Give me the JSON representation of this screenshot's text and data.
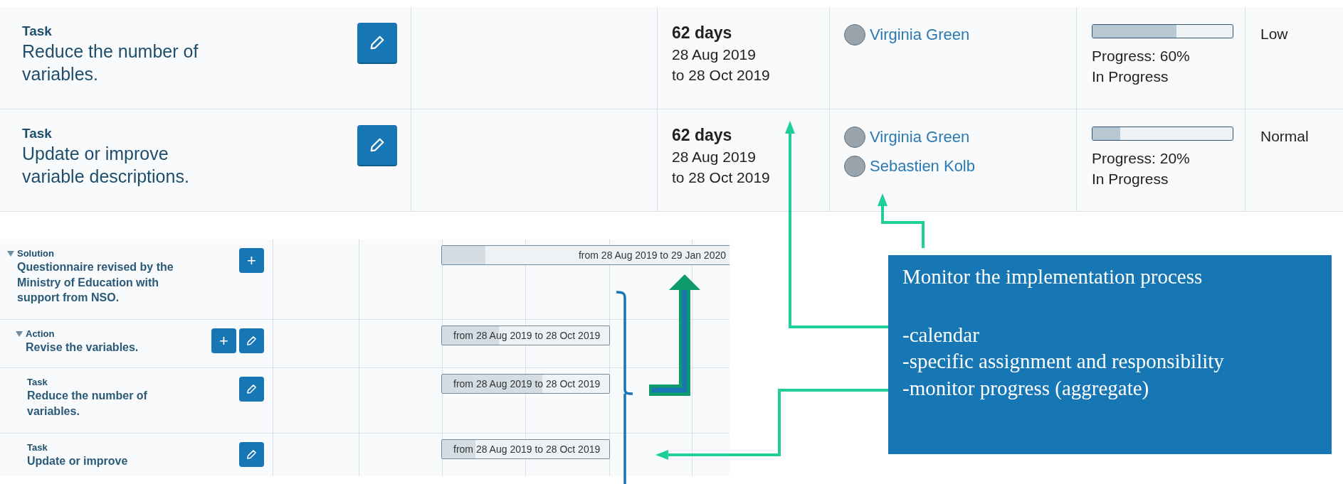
{
  "task_table": {
    "rows": [
      {
        "type_label": "Task",
        "title": "Reduce the number of variables.",
        "duration": "62 days",
        "start": "28 Aug 2019",
        "end": "to 28 Oct 2019",
        "assignees": [
          "Virginia Green"
        ],
        "level": 0.6,
        "progress": "Progress: 60%",
        "status": "In Progress",
        "priority": "Low"
      },
      {
        "type_label": "Task",
        "title": "Update or improve variable descriptions.",
        "duration": "62 days",
        "start": "28 Aug 2019",
        "end": "to 28 Oct 2019",
        "assignees": [
          "Virginia Green",
          "Sebastien Kolb"
        ],
        "level": 0.2,
        "progress": "Progress: 20%",
        "status": "In Progress",
        "priority": "Normal"
      }
    ]
  },
  "gantt": {
    "rows": [
      {
        "kind": "solution",
        "expanded": true,
        "type_label": "Solution",
        "title": "Questionnaire revised by the Ministry of Education with support from NSO.",
        "actions": [
          {
            "kind": "add",
            "label": "+"
          }
        ],
        "bar": "from 28 Aug 2019 to 29 Jan 2020",
        "level": 0.15
      },
      {
        "kind": "action",
        "expanded": true,
        "type_label": "Action",
        "title": "Revise the variables.",
        "actions": [
          {
            "kind": "add",
            "label": "+"
          },
          {
            "kind": "edit"
          }
        ],
        "bar": "from 28 Aug 2019 to 28 Oct 2019",
        "level": 0.34
      },
      {
        "kind": "task",
        "type_label": "Task",
        "title": "Reduce the number of variables.",
        "actions": [
          {
            "kind": "edit"
          }
        ],
        "bar": "from 28 Aug 2019 to 28 Oct 2019",
        "level": 0.6
      },
      {
        "kind": "task",
        "type_label": "Task",
        "title": "Update or improve",
        "actions": [
          {
            "kind": "edit"
          }
        ],
        "bar": "from 28 Aug 2019 to 28 Oct 2019",
        "level": 0.2
      }
    ]
  },
  "callout": {
    "title": "Monitor the implementation process",
    "items": [
      "-calendar",
      "-specific assignment and responsibility",
      "-monitor progress (aggregate)"
    ]
  }
}
